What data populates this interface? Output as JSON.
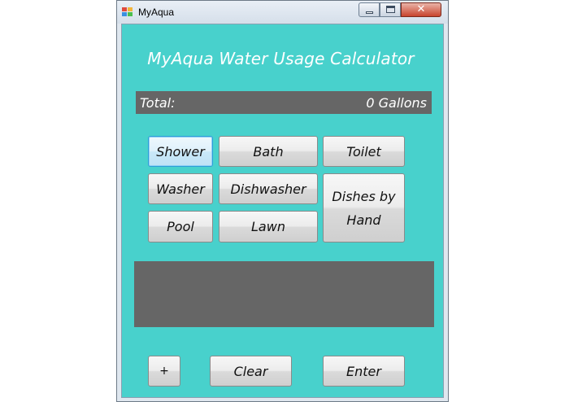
{
  "window": {
    "title": "MyAqua",
    "icon": "myaqua-app-icon",
    "controls": {
      "minimize": "minimize-icon",
      "maximize": "maximize-icon",
      "close": "close-icon"
    }
  },
  "app": {
    "heading": "MyAqua Water Usage Calculator",
    "total_label": "Total:",
    "total_value": "0 Gallons",
    "background_color": "#48d1cc",
    "panel_color": "#666666"
  },
  "buttons": {
    "shower": "Shower",
    "bath": "Bath",
    "toilet": "Toilet",
    "washer": "Washer",
    "dishwasher": "Dishwasher",
    "dishes_by_hand": "Dishes by Hand",
    "pool": "Pool",
    "lawn": "Lawn",
    "plus": "+",
    "clear": "Clear",
    "enter": "Enter"
  },
  "output": {
    "text": ""
  }
}
